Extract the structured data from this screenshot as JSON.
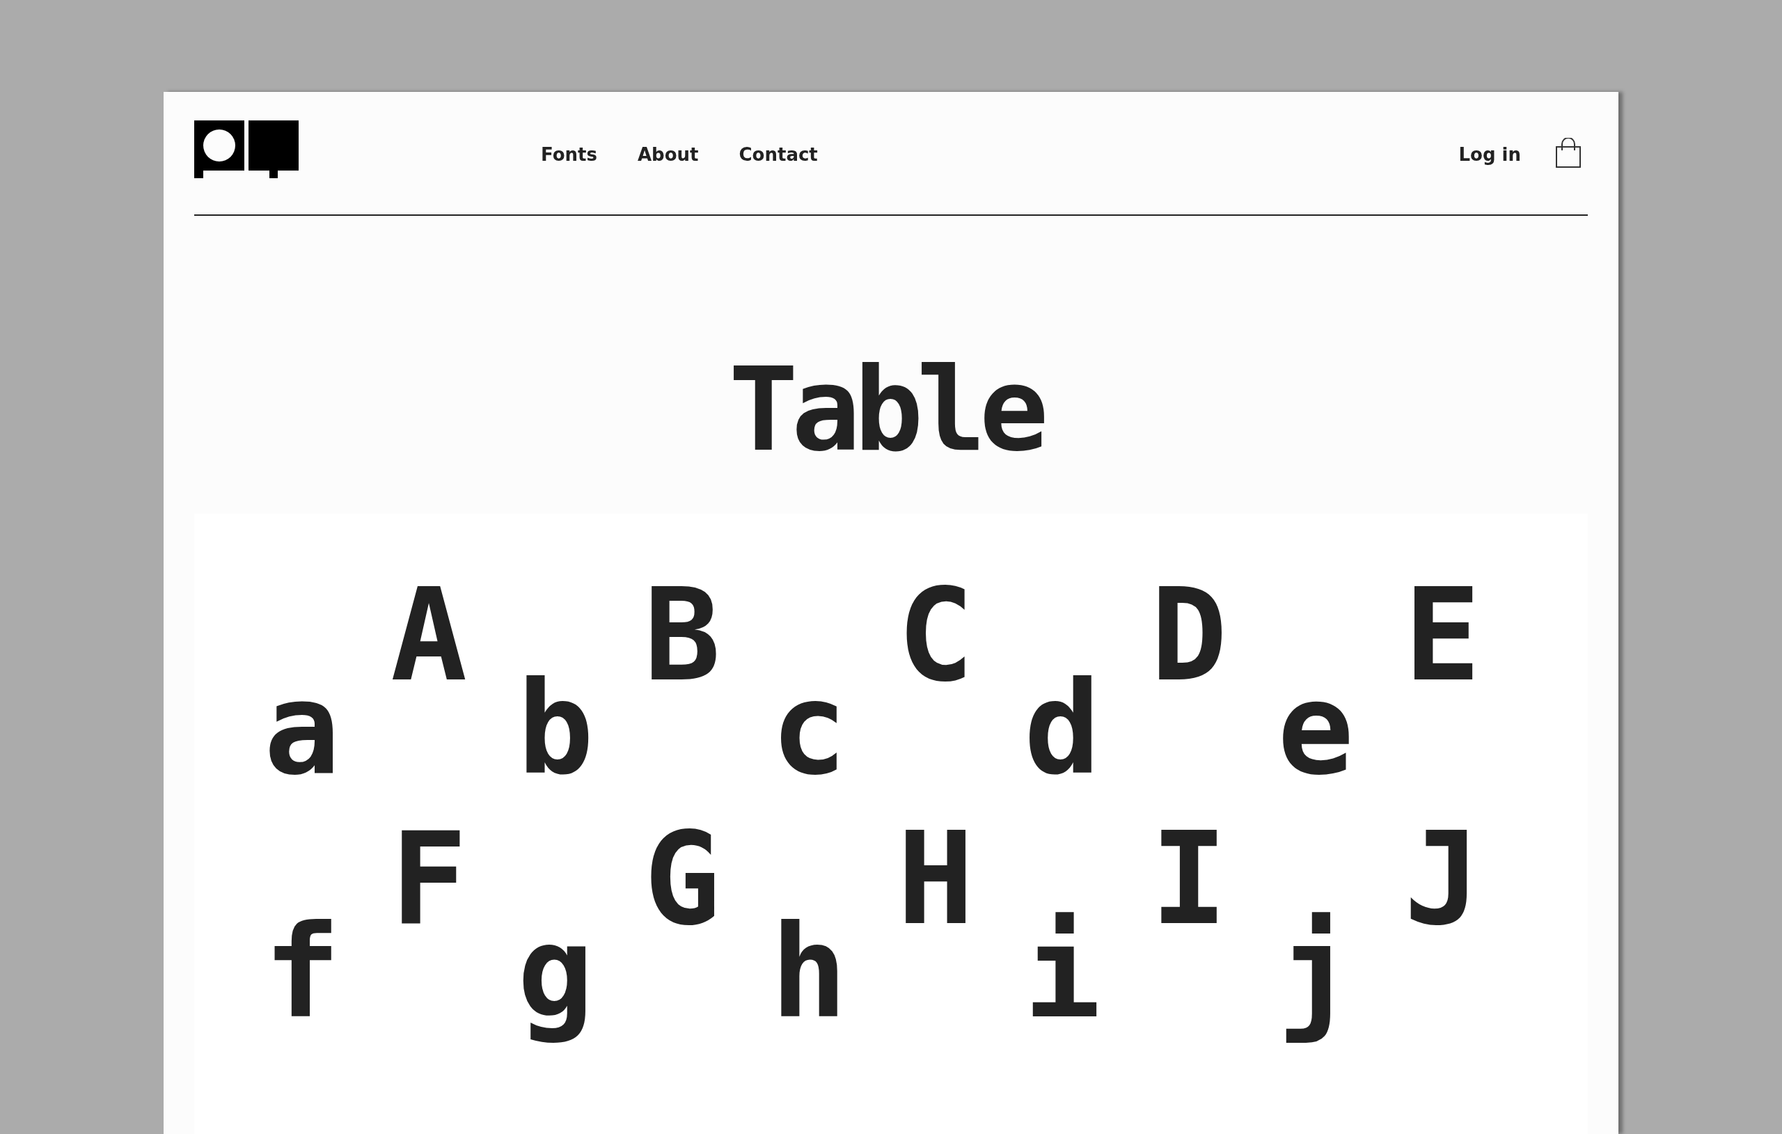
{
  "nav": [
    "Fonts",
    "About",
    "Contact"
  ],
  "account": {
    "login": "Log in"
  },
  "title": "Table",
  "glyph_pairs": [
    {
      "lower": "a",
      "upper": "A"
    },
    {
      "lower": "b",
      "upper": "B"
    },
    {
      "lower": "c",
      "upper": "C"
    },
    {
      "lower": "d",
      "upper": "D"
    },
    {
      "lower": "e",
      "upper": "E"
    },
    {
      "lower": "f",
      "upper": "F"
    },
    {
      "lower": "g",
      "upper": "G"
    },
    {
      "lower": "h",
      "upper": "H"
    },
    {
      "lower": "i",
      "upper": "I"
    },
    {
      "lower": "j",
      "upper": "J"
    }
  ]
}
